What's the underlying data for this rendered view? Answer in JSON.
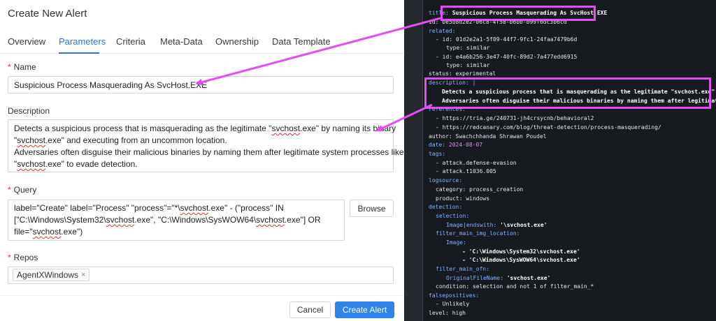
{
  "form": {
    "title": "Create New Alert",
    "tabs": [
      "Overview",
      "Parameters",
      "Criteria",
      "Meta-Data",
      "Ownership",
      "Data Template"
    ],
    "name_label": "Name",
    "name_value": "Suspicious Process Masquerading As SvcHost.EXE",
    "description_label": "Description",
    "description_lines": [
      "Detects a suspicious process that is masquerading as the legitimate \"svchost.exe\" by naming its binary",
      "\"svchost.exe\" and executing from an uncommon location.",
      "    Adversaries often disguise their malicious binaries by naming them after legitimate system processes like",
      "\"svchost.exe\" to evade detection."
    ],
    "query_label": "Query",
    "query_lines": [
      "label=\"Create\" label=\"Process\" \"process\"=\"*\\svchost.exe\" - (\"process\" IN",
      "[\"C:\\Windows\\System32\\svchost.exe\", \"C:\\Windows\\SysWOW64\\svchost.exe\"] OR",
      "file=\"svchost.exe\")"
    ],
    "browse_label": "Browse",
    "repos_label": "Repos",
    "repo_tag": "AgentXWindows",
    "repo_tag_remove": "×",
    "cancel_label": "Cancel",
    "create_label": "Create Alert"
  },
  "yaml": {
    "title_key": "title:",
    "title_val": "Suspicious Process Masquerading As SvcHost.EXE",
    "id_line": "id: be5b8d2e2-06c8-4f58-b6bb-b99f6dc3b6cd",
    "related_key": "related:",
    "rel1_id": "- id: 01d2e2a1-5f09-44f7-9fc1-24faa7479b6d",
    "rel1_type": "type: similar",
    "rel2_id": "- id: e4a6b256-3e47-40fc-89d2-7a477edd6915",
    "rel2_type": "type: similar",
    "status_line": "status: experimental",
    "description_key": "description: |",
    "desc_line1": "Detects a suspicious process that is masquerading as the legitimate \"svchost.exe\" by nami",
    "desc_line2": "Adversaries often disguise their malicious binaries by naming them after legitimate syste",
    "references_key": "references:",
    "ref1": "- https://tria.ge/240731-jh4crsycnb/behavioral2",
    "ref2": "- https://redcanary.com/blog/threat-detection/process-masquerading/",
    "author_line": "author: Swachchhanda Shrawan Poudel",
    "date_key": "date:",
    "date_val": "2024-08-07",
    "tags_key": "tags:",
    "tag1": "- attack.defense-evasion",
    "tag2": "- attack.t1036.005",
    "logsource_key": "logsource:",
    "category_line": "category: process_creation",
    "product_line": "product: windows",
    "detection_key": "detection:",
    "selection_key": "selection:",
    "imageendswith_key": "Image|endswith:",
    "imageendswith_val": "'\\svchost.exe'",
    "filter_loc_key": "filter_main_img_location:",
    "image_key": "Image:",
    "img1": "- 'C:\\Windows\\System32\\svchost.exe'",
    "img2": "- 'C:\\Windows\\SysWOW64\\svchost.exe'",
    "filter_ofn_key": "filter_main_ofn:",
    "ofn_key": "OriginalFileName:",
    "ofn_val": "'svchost.exe'",
    "condition_line": "condition: selection and not 1 of filter_main_*",
    "fp_key": "falsepositives:",
    "fp1": "- Unlikely",
    "level_line": "level: high"
  },
  "colors": {
    "accent": "#2f73e0",
    "highlight": "#e24ef1",
    "required": "#e0342d"
  }
}
